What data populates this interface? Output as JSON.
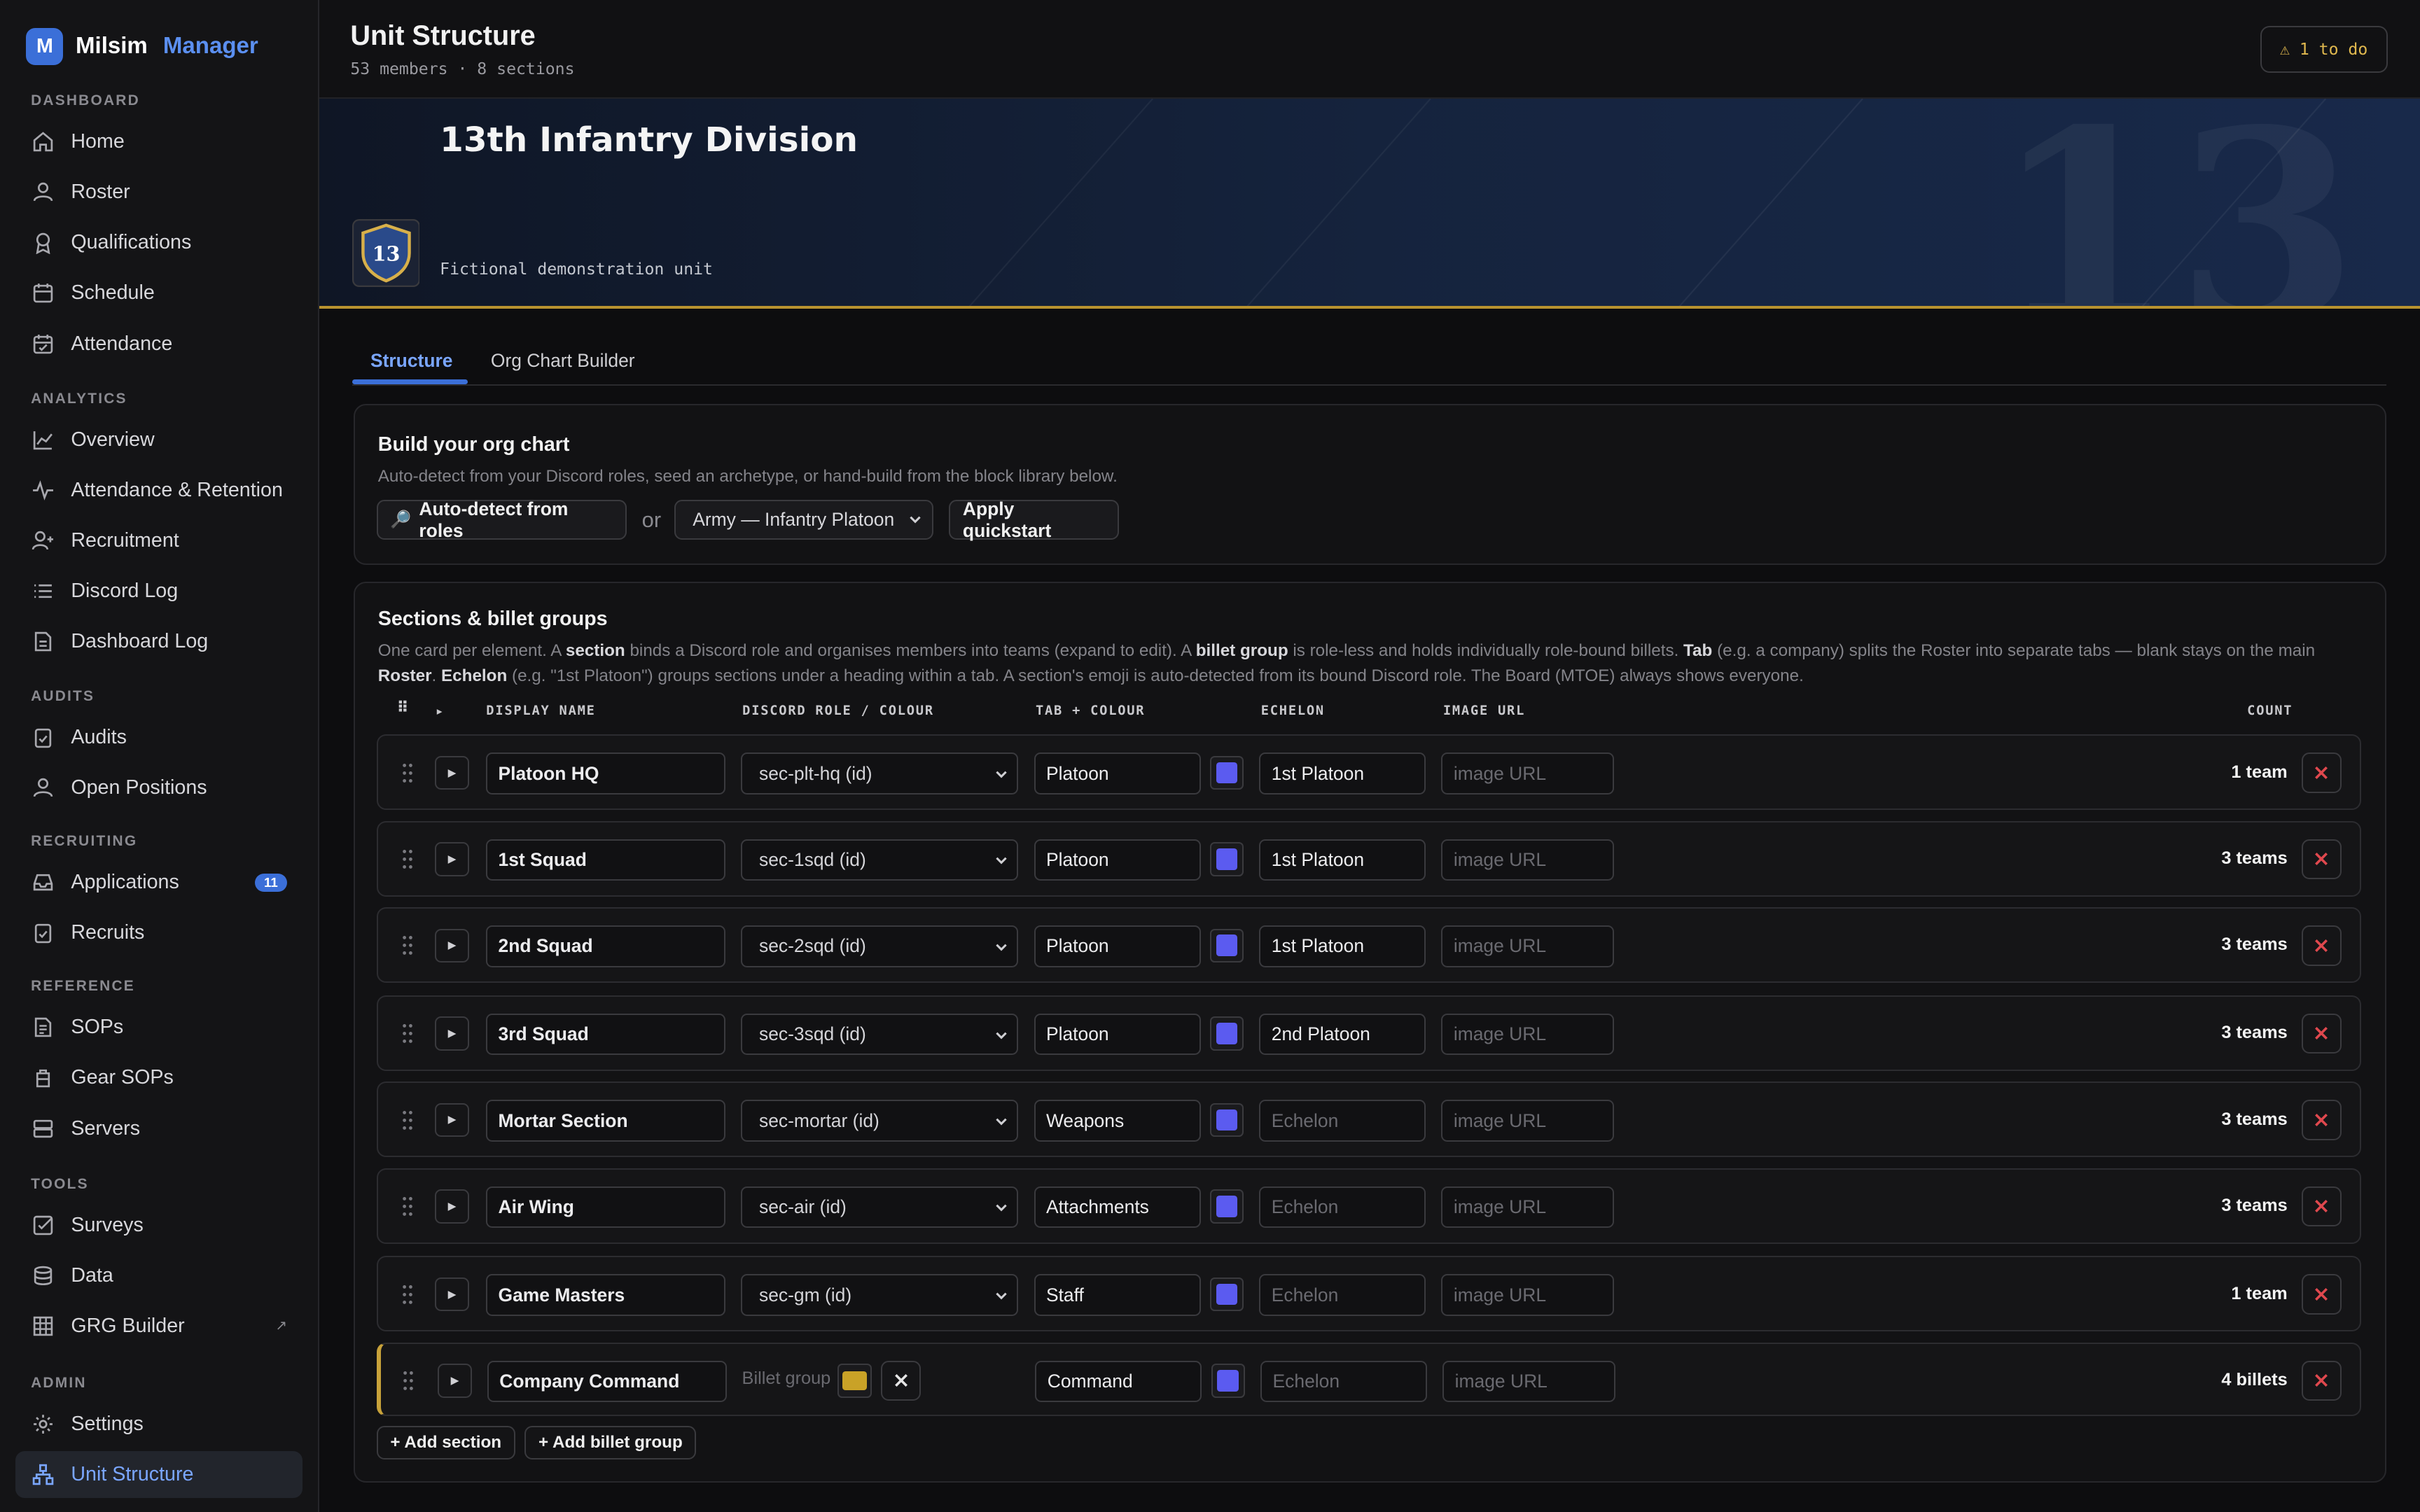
{
  "brand": {
    "name": "Milsim",
    "accent": "Manager",
    "logo_letter": "M"
  },
  "sidebar": {
    "sections": [
      {
        "label": "DASHBOARD",
        "items": [
          {
            "label": "Home",
            "icon": "home-icon"
          },
          {
            "label": "Roster",
            "icon": "user-icon"
          },
          {
            "label": "Qualifications",
            "icon": "award-icon"
          },
          {
            "label": "Schedule",
            "icon": "calendar-icon"
          },
          {
            "label": "Attendance",
            "icon": "calendar-check-icon"
          }
        ]
      },
      {
        "label": "ANALYTICS",
        "items": [
          {
            "label": "Overview",
            "icon": "line-chart-icon"
          },
          {
            "label": "Attendance & Retention",
            "icon": "activity-icon"
          },
          {
            "label": "Recruitment",
            "icon": "user-plus-icon"
          },
          {
            "label": "Discord Log",
            "icon": "list-icon"
          },
          {
            "label": "Dashboard Log",
            "icon": "file-icon"
          }
        ]
      },
      {
        "label": "AUDITS",
        "items": [
          {
            "label": "Audits",
            "icon": "clipboard-check-icon"
          },
          {
            "label": "Open Positions",
            "icon": "user-icon"
          }
        ]
      },
      {
        "label": "RECRUITING",
        "items": [
          {
            "label": "Applications",
            "icon": "inbox-icon",
            "badge": "11"
          },
          {
            "label": "Recruits",
            "icon": "clipboard-check-icon"
          }
        ]
      },
      {
        "label": "REFERENCE",
        "items": [
          {
            "label": "SOPs",
            "icon": "file-text-icon"
          },
          {
            "label": "Gear SOPs",
            "icon": "backpack-icon"
          },
          {
            "label": "Servers",
            "icon": "server-icon"
          }
        ]
      },
      {
        "label": "TOOLS",
        "items": [
          {
            "label": "Surveys",
            "icon": "check-square-icon"
          },
          {
            "label": "Data",
            "icon": "database-icon"
          },
          {
            "label": "GRG Builder",
            "icon": "grid-icon",
            "external": "↗"
          }
        ]
      },
      {
        "label": "ADMIN",
        "items": [
          {
            "label": "Settings",
            "icon": "gear-icon"
          },
          {
            "label": "Unit Structure",
            "icon": "network-icon",
            "active": true
          }
        ]
      }
    ]
  },
  "header": {
    "title": "Unit Structure",
    "subtitle": "53 members · 8 sections",
    "todo": "⚠ 1 to do"
  },
  "banner": {
    "unit_name": "13th Infantry Division",
    "unit_sub": "Fictional demonstration unit",
    "crest_number": "13",
    "bg_number": "13"
  },
  "tabs": [
    {
      "label": "Structure",
      "active": true
    },
    {
      "label": "Org Chart Builder",
      "active": false
    }
  ],
  "build": {
    "title": "Build your org chart",
    "desc": "Auto-detect from your Discord roles, seed an archetype, or hand-build from the block library below.",
    "auto_detect": "Auto-detect from roles",
    "or": "or",
    "archetype": "Army — Infantry Platoon",
    "apply": "Apply quickstart"
  },
  "sections_card": {
    "title": "Sections & billet groups",
    "desc_parts": {
      "p1": "One card per element. A ",
      "b1": "section",
      "p2": " binds a Discord role and organises members into teams (expand to edit). A ",
      "b2": "billet group",
      "p3": " is role-less and holds individually role-bound billets. ",
      "b3": "Tab",
      "p4": " (e.g. a company) splits the Roster into separate tabs — blank stays on the main ",
      "b4": "Roster",
      "p5": ". ",
      "b5": "Echelon",
      "p6": " (e.g. \"1st Platoon\") groups sections under a heading within a tab. A section's emoji is auto-detected from its bound Discord role. The Board (MTOE) always shows everyone."
    },
    "columns": {
      "drag": "⠿",
      "expand": "▸",
      "name": "DISPLAY NAME",
      "role": "DISCORD ROLE / COLOUR",
      "tab": "TAB + COLOUR",
      "echelon": "ECHELON",
      "image": "IMAGE URL",
      "count": "COUNT"
    },
    "placeholders": {
      "echelon": "Echelon",
      "image": "image URL"
    },
    "rows": [
      {
        "name": "Platoon HQ",
        "role": "sec-plt-hq (id)",
        "tab": "Platoon",
        "echelon": "1st Platoon",
        "count": "1 team"
      },
      {
        "name": "1st Squad",
        "role": "sec-1sqd (id)",
        "tab": "Platoon",
        "echelon": "1st Platoon",
        "count": "3 teams"
      },
      {
        "name": "2nd Squad",
        "role": "sec-2sqd (id)",
        "tab": "Platoon",
        "echelon": "1st Platoon",
        "count": "3 teams"
      },
      {
        "name": "3rd Squad",
        "role": "sec-3sqd (id)",
        "tab": "Platoon",
        "echelon": "2nd Platoon",
        "count": "3 teams"
      },
      {
        "name": "Mortar Section",
        "role": "sec-mortar (id)",
        "tab": "Weapons",
        "echelon": "",
        "count": "3 teams"
      },
      {
        "name": "Air Wing",
        "role": "sec-air (id)",
        "tab": "Attachments",
        "echelon": "",
        "count": "3 teams"
      },
      {
        "name": "Game Masters",
        "role": "sec-gm (id)",
        "tab": "Staff",
        "echelon": "",
        "count": "1 team"
      }
    ],
    "billet_row": {
      "name": "Company Command",
      "label": "Billet group",
      "tab": "Command",
      "echelon": "",
      "count": "4 billets"
    },
    "add_section": "+ Add section",
    "add_billet": "+ Add billet group"
  },
  "colors": {
    "accent": "#3b6fd8",
    "tab_swatch": "#5b5bf0",
    "billet_swatch": "#c9a227",
    "gold": "#b8922f",
    "danger": "#e0484e"
  }
}
